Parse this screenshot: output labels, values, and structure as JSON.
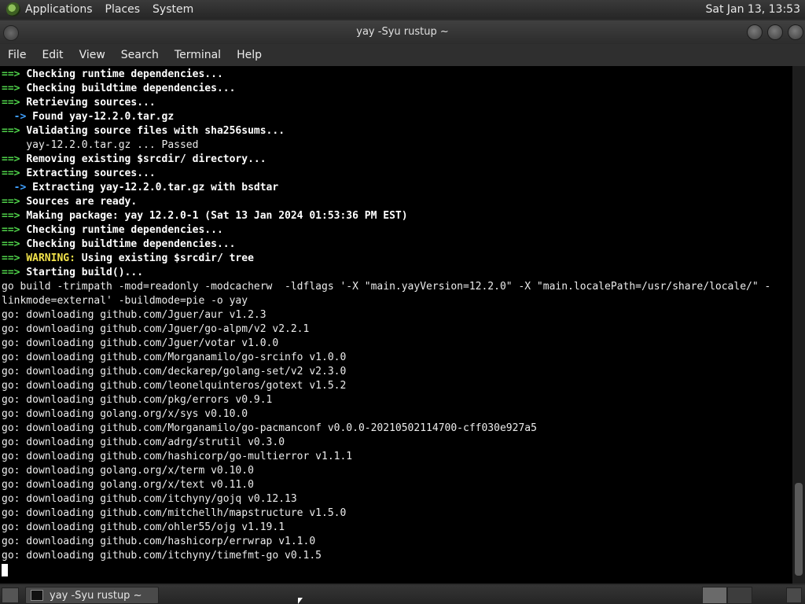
{
  "top_panel": {
    "menus": [
      "Applications",
      "Places",
      "System"
    ],
    "clock": "Sat Jan 13, 13:53"
  },
  "window": {
    "title": "yay -Syu rustup ~"
  },
  "menu_bar": [
    "File",
    "Edit",
    "View",
    "Search",
    "Terminal",
    "Help"
  ],
  "terminal": {
    "lines": [
      {
        "kind": "step",
        "text": "Checking runtime dependencies..."
      },
      {
        "kind": "step",
        "text": "Checking buildtime dependencies..."
      },
      {
        "kind": "step",
        "text": "Retrieving sources..."
      },
      {
        "kind": "sub",
        "text": "Found yay-12.2.0.tar.gz"
      },
      {
        "kind": "step",
        "text": "Validating source files with sha256sums..."
      },
      {
        "kind": "plain",
        "text": "    yay-12.2.0.tar.gz ... Passed"
      },
      {
        "kind": "step",
        "text": "Removing existing $srcdir/ directory..."
      },
      {
        "kind": "step",
        "text": "Extracting sources..."
      },
      {
        "kind": "sub",
        "text": "Extracting yay-12.2.0.tar.gz with bsdtar"
      },
      {
        "kind": "step",
        "text": "Sources are ready."
      },
      {
        "kind": "step",
        "text": "Making package: yay 12.2.0-1 (Sat 13 Jan 2024 01:53:36 PM EST)"
      },
      {
        "kind": "step",
        "text": "Checking runtime dependencies..."
      },
      {
        "kind": "step",
        "text": "Checking buildtime dependencies..."
      },
      {
        "kind": "warning",
        "label": "WARNING:",
        "text": " Using existing $srcdir/ tree"
      },
      {
        "kind": "step",
        "text": "Starting build()..."
      },
      {
        "kind": "plain",
        "text": "go build -trimpath -mod=readonly -modcacherw  -ldflags '-X \"main.yayVersion=12.2.0\" -X \"main.localePath=/usr/share/locale/\" -"
      },
      {
        "kind": "plain",
        "text": "linkmode=external' -buildmode=pie -o yay"
      },
      {
        "kind": "plain",
        "text": "go: downloading github.com/Jguer/aur v1.2.3"
      },
      {
        "kind": "plain",
        "text": "go: downloading github.com/Jguer/go-alpm/v2 v2.2.1"
      },
      {
        "kind": "plain",
        "text": "go: downloading github.com/Jguer/votar v1.0.0"
      },
      {
        "kind": "plain",
        "text": "go: downloading github.com/Morganamilo/go-srcinfo v1.0.0"
      },
      {
        "kind": "plain",
        "text": "go: downloading github.com/deckarep/golang-set/v2 v2.3.0"
      },
      {
        "kind": "plain",
        "text": "go: downloading github.com/leonelquinteros/gotext v1.5.2"
      },
      {
        "kind": "plain",
        "text": "go: downloading github.com/pkg/errors v0.9.1"
      },
      {
        "kind": "plain",
        "text": "go: downloading golang.org/x/sys v0.10.0"
      },
      {
        "kind": "plain",
        "text": "go: downloading github.com/Morganamilo/go-pacmanconf v0.0.0-20210502114700-cff030e927a5"
      },
      {
        "kind": "plain",
        "text": "go: downloading github.com/adrg/strutil v0.3.0"
      },
      {
        "kind": "plain",
        "text": "go: downloading github.com/hashicorp/go-multierror v1.1.1"
      },
      {
        "kind": "plain",
        "text": "go: downloading golang.org/x/term v0.10.0"
      },
      {
        "kind": "plain",
        "text": "go: downloading golang.org/x/text v0.11.0"
      },
      {
        "kind": "plain",
        "text": "go: downloading github.com/itchyny/gojq v0.12.13"
      },
      {
        "kind": "plain",
        "text": "go: downloading github.com/mitchellh/mapstructure v1.5.0"
      },
      {
        "kind": "plain",
        "text": "go: downloading github.com/ohler55/ojg v1.19.1"
      },
      {
        "kind": "plain",
        "text": "go: downloading github.com/hashicorp/errwrap v1.1.0"
      },
      {
        "kind": "plain",
        "text": "go: downloading github.com/itchyny/timefmt-go v0.1.5"
      }
    ],
    "step_prefix": "==> ",
    "sub_prefix": "  -> "
  },
  "taskbar": {
    "task_label": "yay -Syu rustup ~"
  },
  "colors": {
    "step_arrow": "#4fd24a",
    "sub_arrow": "#3fa0ff",
    "warning": "#f2e34a",
    "terminal_bg": "#000000"
  },
  "icons": [
    "distro-logo-icon",
    "window-menu-icon",
    "minimize-icon",
    "maximize-icon",
    "close-icon",
    "terminal-icon",
    "show-desktop-icon",
    "trash-icon"
  ]
}
